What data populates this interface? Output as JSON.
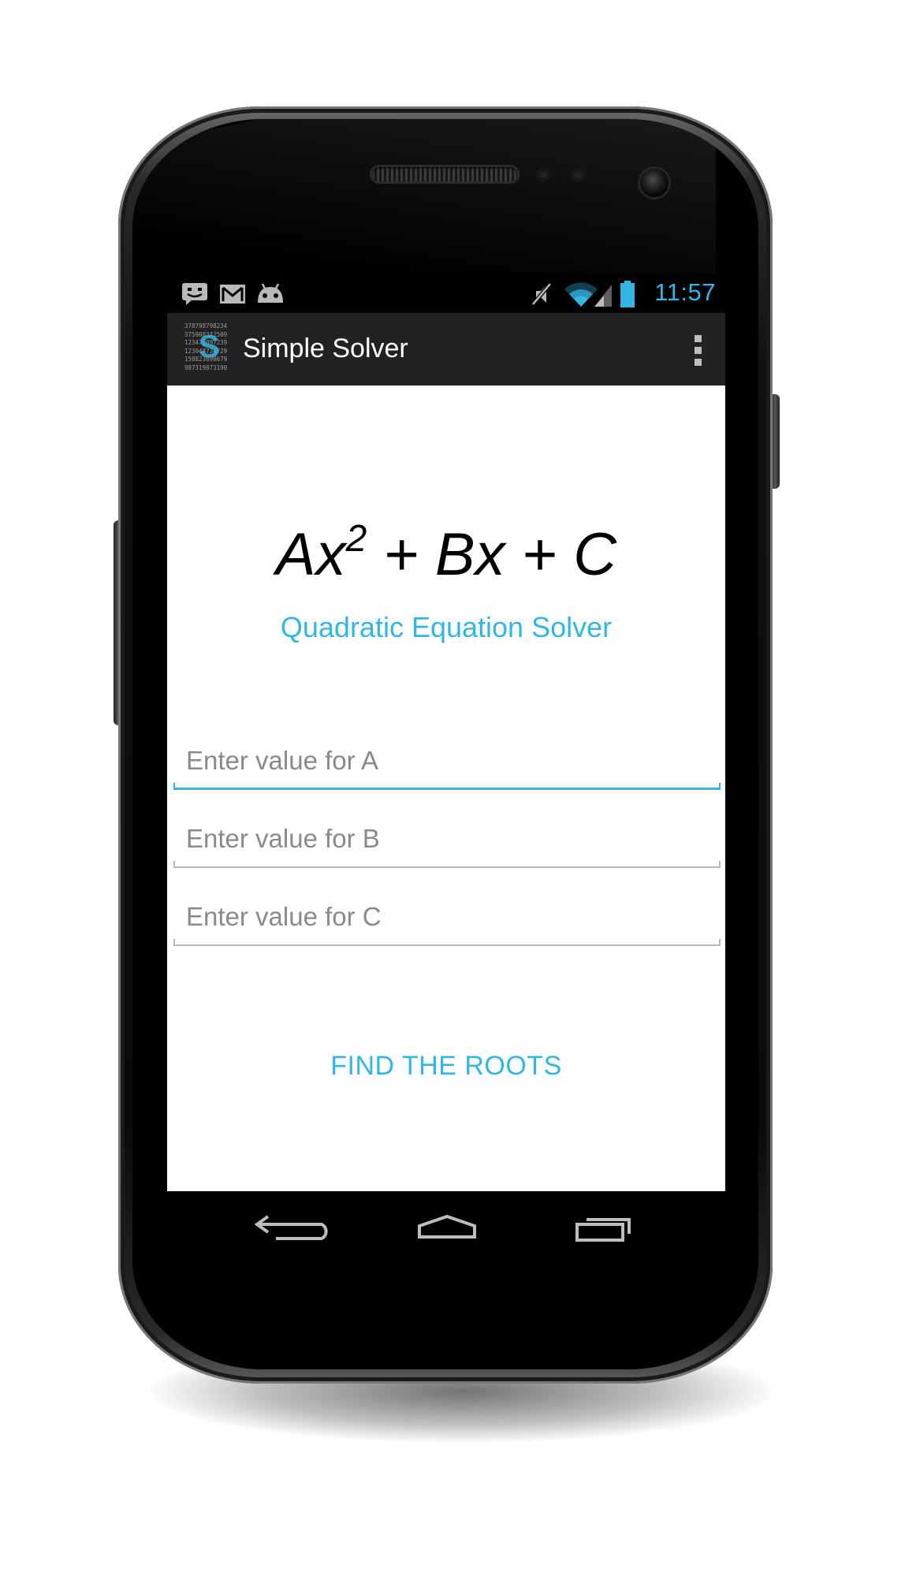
{
  "status_bar": {
    "time": "11:57",
    "icons": [
      "chat-notification-icon",
      "gmail-icon",
      "android-icon",
      "muted-icon",
      "wifi-icon",
      "signal-icon",
      "battery-icon"
    ]
  },
  "action_bar": {
    "app_icon": {
      "name": "simple-solver-logo-icon",
      "digits": [
        "378798798234",
        "375908342509",
        "123475097239",
        "123948734729",
        "150823890679",
        "987319873190"
      ],
      "letter": "S"
    },
    "title": "Simple Solver",
    "overflow_icon": "overflow-menu-icon"
  },
  "main": {
    "equation": {
      "part1": "Ax",
      "exponent": "2",
      "part2": " + Bx + C"
    },
    "subtitle": "Quadratic Equation Solver",
    "fields": [
      {
        "placeholder": "Enter value for A",
        "value": "",
        "focused": true
      },
      {
        "placeholder": "Enter value for B",
        "value": "",
        "focused": false
      },
      {
        "placeholder": "Enter value for C",
        "value": "",
        "focused": false
      }
    ],
    "submit_label": "FIND THE ROOTS"
  },
  "nav_bar": {
    "buttons": [
      "back-icon",
      "home-icon",
      "recent-apps-icon"
    ]
  },
  "colors": {
    "accent": "#33b5e5",
    "action_bar_bg": "#222222",
    "status_bar_bg": "#000000",
    "screen_bg": "#ffffff"
  }
}
